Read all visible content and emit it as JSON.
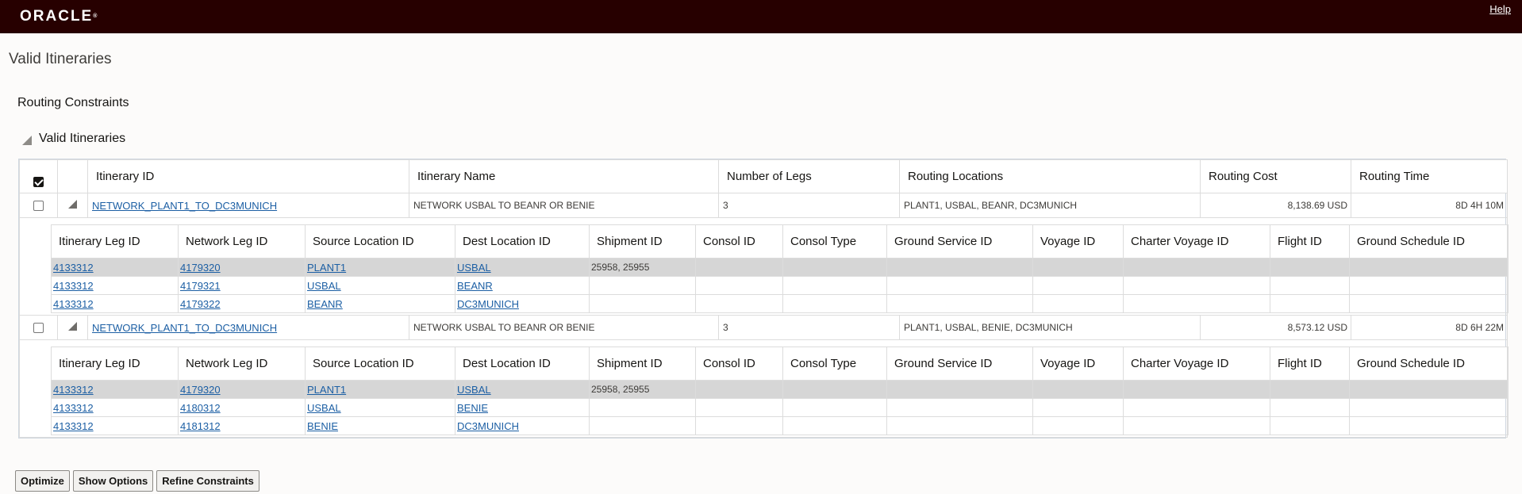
{
  "header": {
    "logo": "ORACLE",
    "help": "Help"
  },
  "page": {
    "title": "Valid Itineraries",
    "subtitle": "Routing Constraints",
    "section_title": "Valid Itineraries"
  },
  "main_table": {
    "columns": [
      "Itinerary ID",
      "Itinerary Name",
      "Number of Legs",
      "Routing Locations",
      "Routing Cost",
      "Routing Time"
    ],
    "rows": [
      {
        "itinerary_id": "NETWORK_PLANT1_TO_DC3MUNICH",
        "itinerary_name": "NETWORK USBAL TO BEANR OR BENIE",
        "number_of_legs": "3",
        "routing_locations": "PLANT1, USBAL, BEANR, DC3MUNICH",
        "routing_cost": "8,138.69 USD",
        "routing_time": "8D 4H 10M",
        "legs": [
          {
            "itinerary_leg_id": "4133312",
            "network_leg_id": "4179320",
            "source": "PLANT1",
            "dest": "USBAL",
            "shipment_id": "25958, 25955",
            "selected": true
          },
          {
            "itinerary_leg_id": "4133312",
            "network_leg_id": "4179321",
            "source": "USBAL",
            "dest": "BEANR",
            "shipment_id": "",
            "selected": false
          },
          {
            "itinerary_leg_id": "4133312",
            "network_leg_id": "4179322",
            "source": "BEANR",
            "dest": "DC3MUNICH",
            "shipment_id": "",
            "selected": false
          }
        ]
      },
      {
        "itinerary_id": "NETWORK_PLANT1_TO_DC3MUNICH",
        "itinerary_name": "NETWORK USBAL TO BEANR OR BENIE",
        "number_of_legs": "3",
        "routing_locations": "PLANT1, USBAL, BENIE, DC3MUNICH",
        "routing_cost": "8,573.12 USD",
        "routing_time": "8D 6H 22M",
        "legs": [
          {
            "itinerary_leg_id": "4133312",
            "network_leg_id": "4179320",
            "source": "PLANT1",
            "dest": "USBAL",
            "shipment_id": "25958, 25955",
            "selected": true
          },
          {
            "itinerary_leg_id": "4133312",
            "network_leg_id": "4180312",
            "source": "USBAL",
            "dest": "BENIE",
            "shipment_id": "",
            "selected": false
          },
          {
            "itinerary_leg_id": "4133312",
            "network_leg_id": "4181312",
            "source": "BENIE",
            "dest": "DC3MUNICH",
            "shipment_id": "",
            "selected": false
          }
        ]
      }
    ]
  },
  "leg_table": {
    "columns": [
      "Itinerary Leg ID",
      "Network Leg ID",
      "Source Location ID",
      "Dest Location ID",
      "Shipment ID",
      "Consol ID",
      "Consol Type",
      "Ground Service ID",
      "Voyage ID",
      "Charter Voyage ID",
      "Flight ID",
      "Ground Schedule ID"
    ]
  },
  "buttons": {
    "optimize": "Optimize",
    "show_options": "Show Options",
    "refine_constraints": "Refine Constraints"
  }
}
